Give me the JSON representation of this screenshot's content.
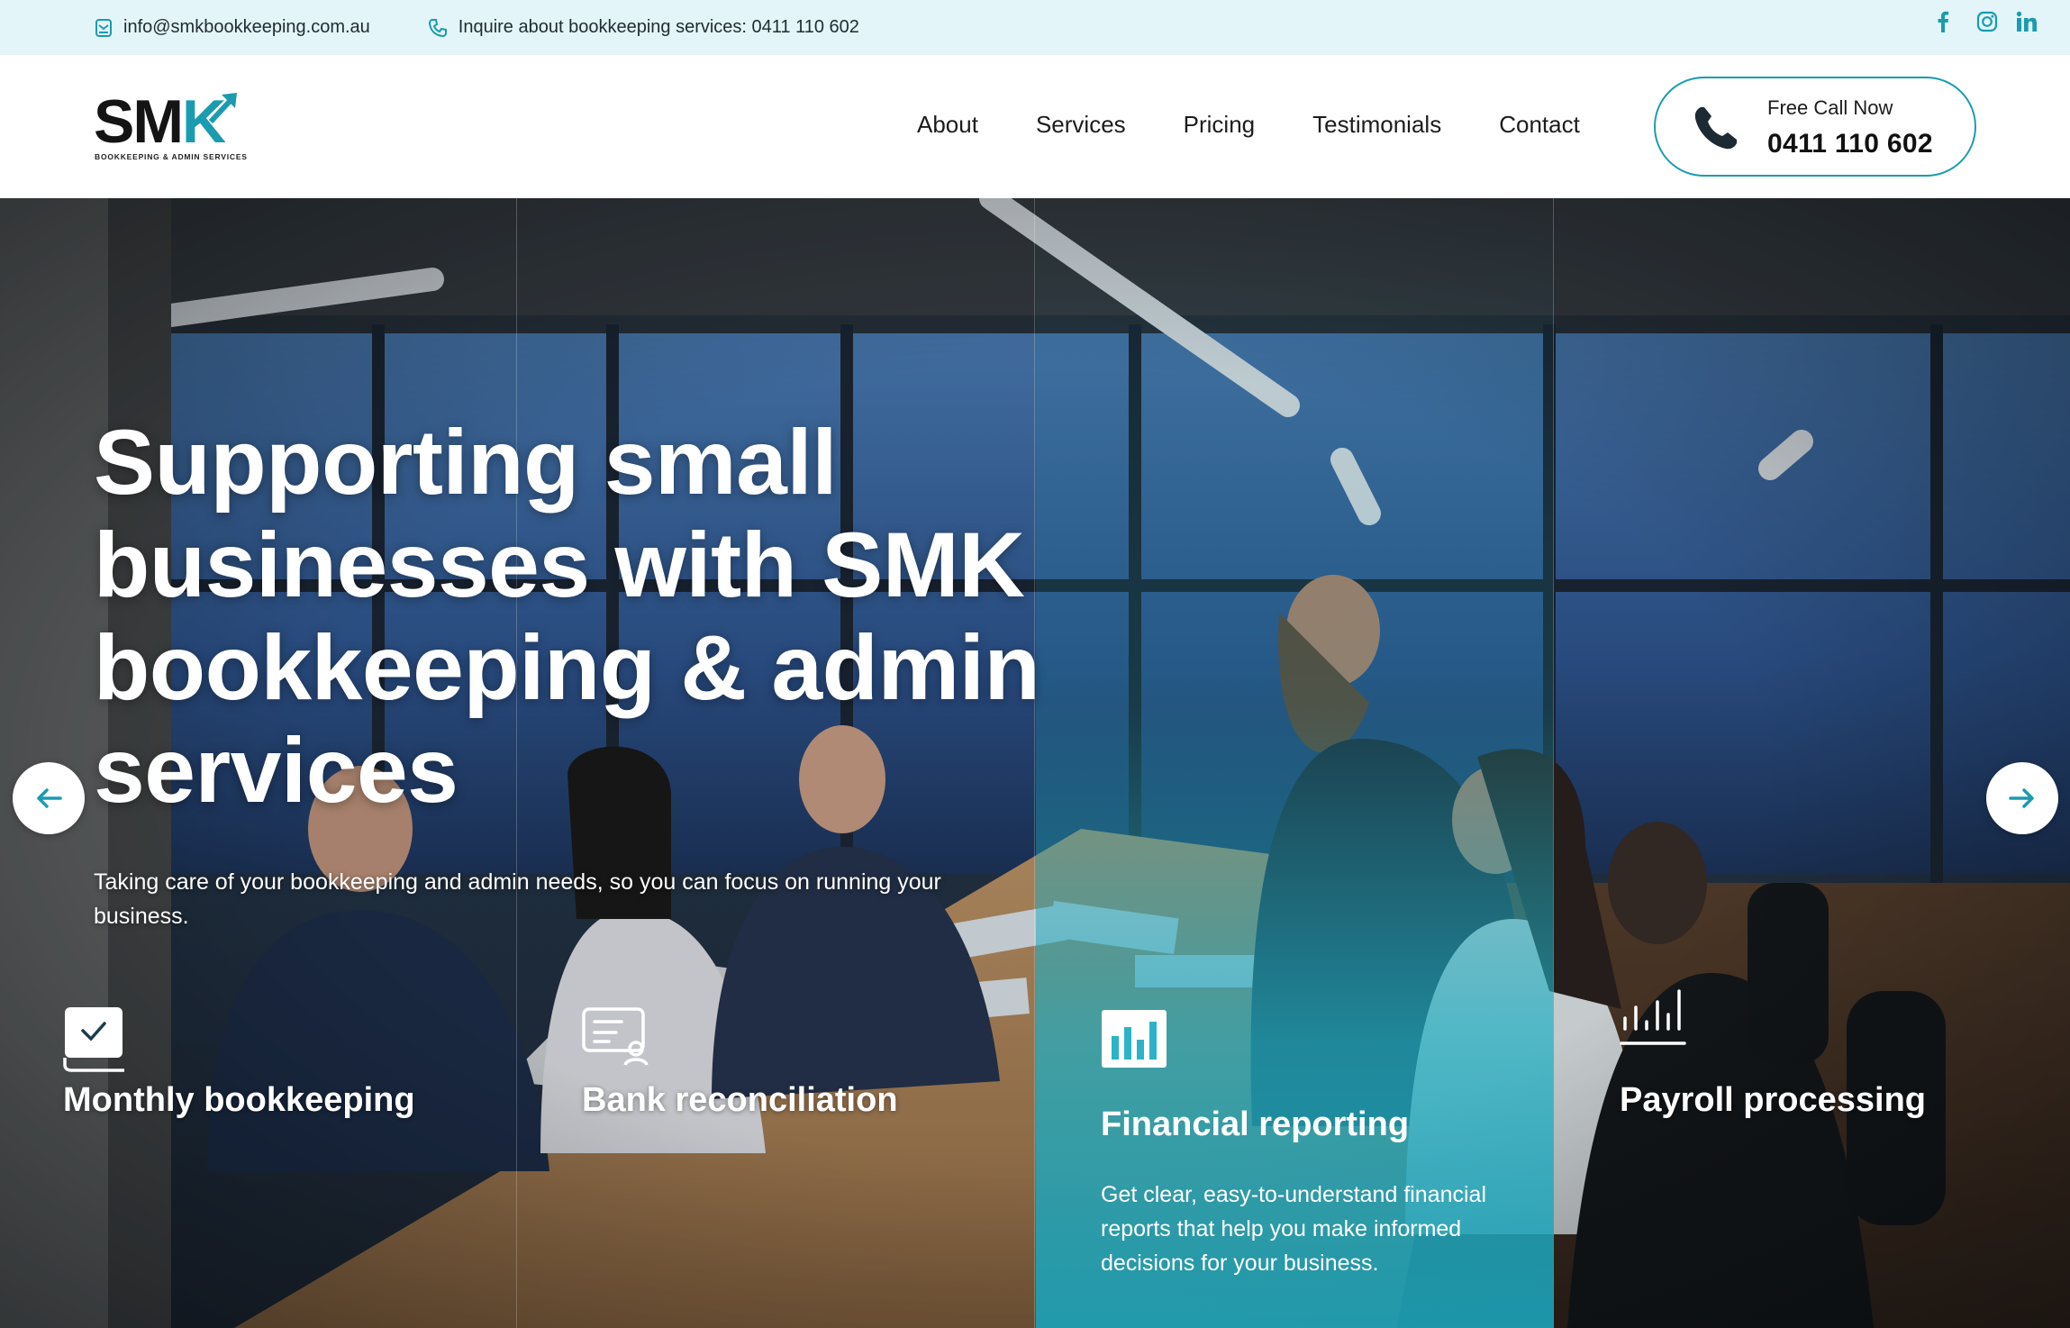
{
  "topbar": {
    "email": "info@smkbookkeeping.com.au",
    "inquiry": "Inquire about bookkeeping services: 0411 110 602",
    "socials": [
      "facebook-icon",
      "instagram-icon",
      "linkedin-icon"
    ]
  },
  "header": {
    "logo_text": "SMK",
    "logo_sub": "BOOKKEEPING & ADMIN SERVICES",
    "nav": [
      "About",
      "Services",
      "Pricing",
      "Testimonials",
      "Contact"
    ],
    "call_label": "Free Call Now",
    "call_number": "0411 110 602"
  },
  "hero": {
    "heading": "Supporting small businesses with SMK bookkeeping & admin services",
    "lead": "Taking care of your bookkeeping and admin needs, so you can focus on running your business."
  },
  "services": [
    {
      "title": "Monthly bookkeeping",
      "icon": "checklist-icon"
    },
    {
      "title": "Bank reconciliation",
      "icon": "statement-icon"
    },
    {
      "title": "Financial reporting",
      "icon": "bar-chart-icon",
      "description": "Get clear, easy-to-understand financial reports that help you make informed decisions for your business."
    },
    {
      "title": "Payroll processing",
      "icon": "payroll-chart-icon"
    }
  ],
  "colors": {
    "accent": "#1a9bb0",
    "topbar_bg": "#e3f5f8",
    "active_card": "#22aec3"
  }
}
